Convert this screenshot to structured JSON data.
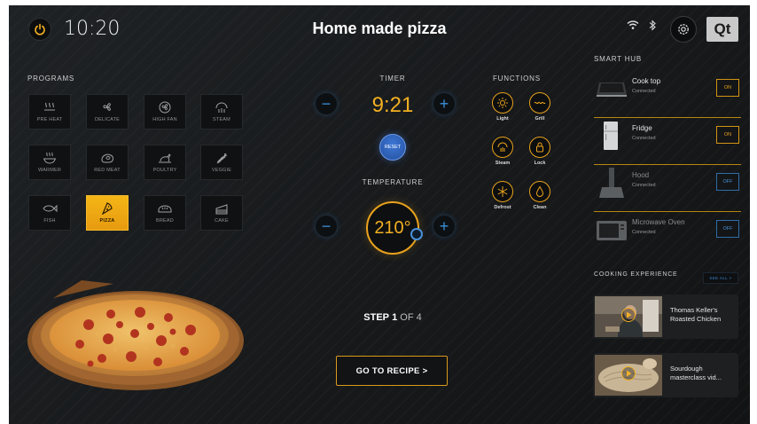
{
  "header": {
    "time": "10:20",
    "title": "Home made pizza",
    "logo_text": "Qt",
    "icons": [
      "power-icon",
      "wifi-icon",
      "bluetooth-icon",
      "gear-icon"
    ]
  },
  "programs": {
    "heading": "PROGRAMS",
    "items": [
      {
        "label": "PRE HEAT",
        "icon": "heat-waves-icon"
      },
      {
        "label": "DELICATE",
        "icon": "fan-icon"
      },
      {
        "label": "HIGH FAN",
        "icon": "high-fan-icon"
      },
      {
        "label": "STEAM",
        "icon": "steam-icon"
      },
      {
        "label": "WARMER",
        "icon": "warmer-icon"
      },
      {
        "label": "RED MEAT",
        "icon": "meat-icon"
      },
      {
        "label": "POULTRY",
        "icon": "poultry-icon"
      },
      {
        "label": "VEGGIE",
        "icon": "carrot-icon"
      },
      {
        "label": "FISH",
        "icon": "fish-icon"
      },
      {
        "label": "PIZZA",
        "icon": "pizza-slice-icon",
        "active": true
      },
      {
        "label": "BREAD",
        "icon": "bread-icon"
      },
      {
        "label": "CAKE",
        "icon": "cake-icon"
      }
    ]
  },
  "timer": {
    "heading": "TIMER",
    "value": "9:21",
    "reset_label": "RESET",
    "minus": "−",
    "plus": "+"
  },
  "temperature": {
    "heading": "TEMPERATURE",
    "value": "210°",
    "minus": "−",
    "plus": "+"
  },
  "functions": {
    "heading": "FUNCTIONS",
    "items": [
      {
        "label": "Light",
        "icon": "light-icon"
      },
      {
        "label": "Grill",
        "icon": "grill-icon"
      },
      {
        "label": "Steam",
        "icon": "steam-icon"
      },
      {
        "label": "Lock",
        "icon": "lock-icon"
      },
      {
        "label": "Defrost",
        "icon": "snowflake-icon"
      },
      {
        "label": "Clean",
        "icon": "droplet-icon"
      }
    ]
  },
  "step": {
    "prefix": "STEP",
    "current": "1",
    "of": "OF 4"
  },
  "recipe_button": "GO TO RECIPE >",
  "smart_hub": {
    "heading": "SMART HUB",
    "devices": [
      {
        "name": "Cook top",
        "status": "Connected",
        "toggle": "ON"
      },
      {
        "name": "Fridge",
        "status": "Connected",
        "toggle": "ON"
      },
      {
        "name": "Hood",
        "status": "Connected",
        "toggle": "OFF"
      },
      {
        "name": "Microwave Oven",
        "status": "Connected",
        "toggle": "OFF"
      }
    ]
  },
  "cooking_experience": {
    "heading": "COOKING EXPERIENCE",
    "see_all": "SEE ALL >",
    "videos": [
      {
        "title": "Thomas Keller's Roasted Chicken"
      },
      {
        "title": "Sourdough masterclass vid..."
      }
    ]
  },
  "colors": {
    "accent": "#f2b022",
    "blue": "#3a8fd8",
    "background": "#1a1c1e"
  }
}
